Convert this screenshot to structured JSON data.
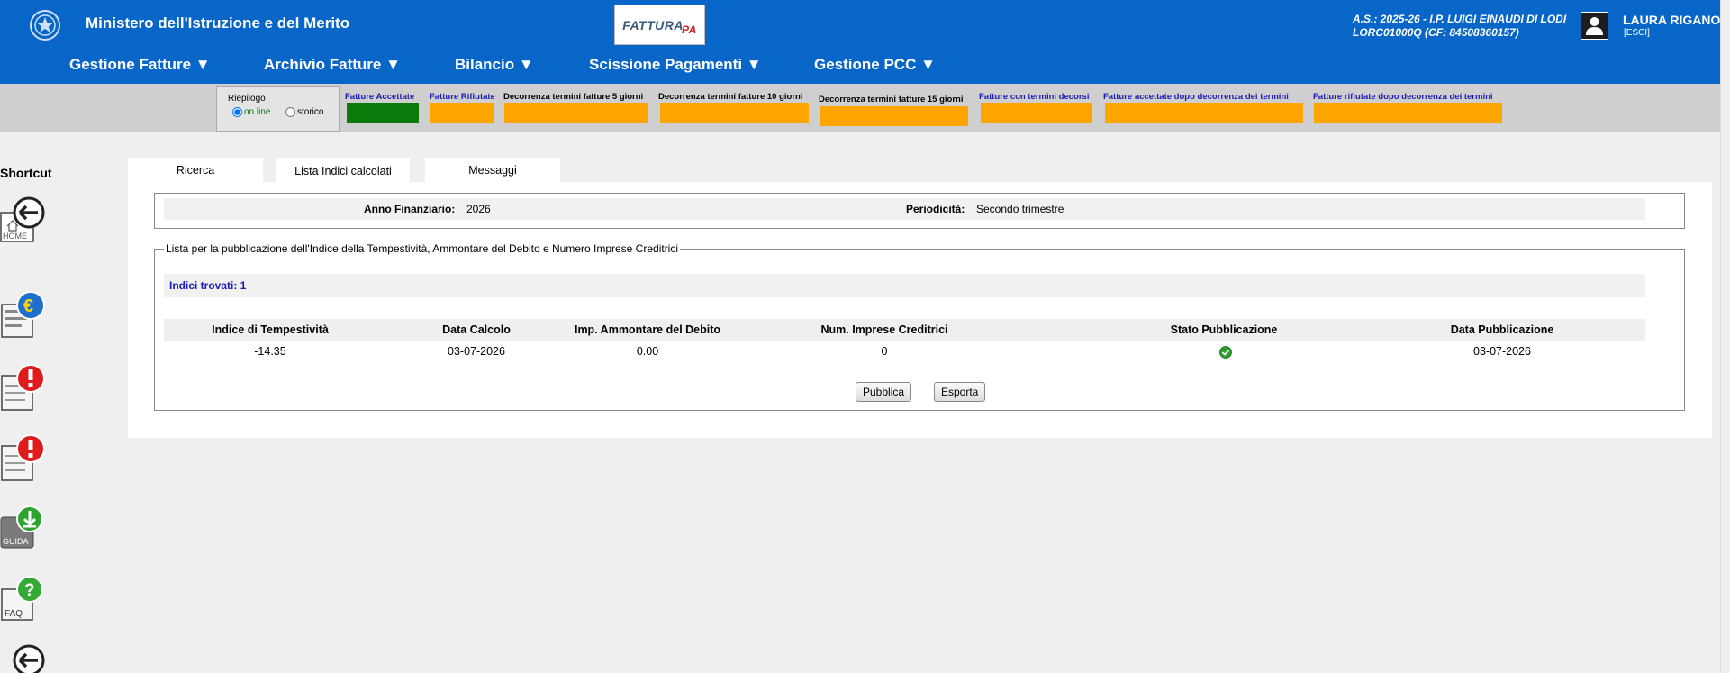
{
  "header": {
    "ministry": "Ministero dell'Istruzione e del Merito",
    "logo_text": "FATTURA",
    "logo_suffix": "PA",
    "school_line1": "A.S.: 2025-26  - I.P. LUIGI EINAUDI DI LODI",
    "school_line2": "LORC01000Q  (CF: 84508360157)",
    "user_name": "LAURA RIGANO'",
    "logout": "[ESCI]",
    "bg_color": "#0766c8"
  },
  "menu": [
    {
      "label": "Gestione Fatture ▼"
    },
    {
      "label": "Archivio Fatture ▼"
    },
    {
      "label": "Bilancio ▼"
    },
    {
      "label": "Scissione Pagamenti ▼"
    },
    {
      "label": "Gestione PCC ▼"
    }
  ],
  "riepilogo": {
    "title": "Riepilogo",
    "online_label": "on line",
    "storico_label": "storico",
    "selected": "on line"
  },
  "status_items": [
    {
      "label": "Fatture Accettate",
      "color": "#0a7a0a"
    },
    {
      "label": "Fatture Rifiutate",
      "color": "#ffa500"
    },
    {
      "label": "Decorrenza termini fatture 5 giorni",
      "color": "#ffa500"
    },
    {
      "label": "Decorrenza termini fatture 10 giorni",
      "color": "#ffa500"
    },
    {
      "label": "Decorrenza termini fatture 15 giorni",
      "color": "#ffa500"
    },
    {
      "label": "Fatture con termini decorsi",
      "color": "#ffa500"
    },
    {
      "label": "Fatture accettate dopo decorrenza dei termini",
      "color": "#ffa500"
    },
    {
      "label": "Fatture rifiutate dopo decorrenza dei termini",
      "color": "#ffa500"
    }
  ],
  "sidebar": {
    "title": "Shortcut",
    "items": [
      {
        "icon": "home-icon",
        "caption": "HOME"
      },
      {
        "icon": "euro-document-icon",
        "caption": ""
      },
      {
        "icon": "alert-document-icon",
        "caption": ""
      },
      {
        "icon": "alert-document-icon",
        "caption": ""
      },
      {
        "icon": "download-guide-icon",
        "caption": "GUIDA"
      },
      {
        "icon": "faq-help-icon",
        "caption": "FAQ"
      },
      {
        "icon": "back-arrow-icon",
        "caption": ""
      }
    ]
  },
  "tabs": [
    {
      "label": "Ricerca",
      "active": false
    },
    {
      "label": "Lista Indici calcolati",
      "active": true
    },
    {
      "label": "Messaggi",
      "active": false
    }
  ],
  "filter": {
    "anno_label": "Anno Finanziario:",
    "anno_value": "2026",
    "periodicita_label": "Periodicità:",
    "periodicita_value": "Secondo trimestre"
  },
  "results": {
    "legend": "Lista per la pubblicazione dell'Indice della Tempestività, Ammontare del Debito e Numero Imprese Creditrici",
    "found": "Indici trovati: 1",
    "columns": [
      "Indice di Tempestività",
      "Data Calcolo",
      "Imp. Ammontare del Debito",
      "Num. Imprese Creditrici",
      "Stato Pubblicazione",
      "Data Pubblicazione"
    ],
    "rows": [
      {
        "indice": "-14.35",
        "data_calcolo": "03-07-2026",
        "importo": "0.00",
        "num_imprese": "0",
        "stato": "published-check-icon",
        "data_pubblicazione": "03-07-2026"
      }
    ],
    "publish_button": "Pubblica",
    "export_button": "Esporta"
  }
}
